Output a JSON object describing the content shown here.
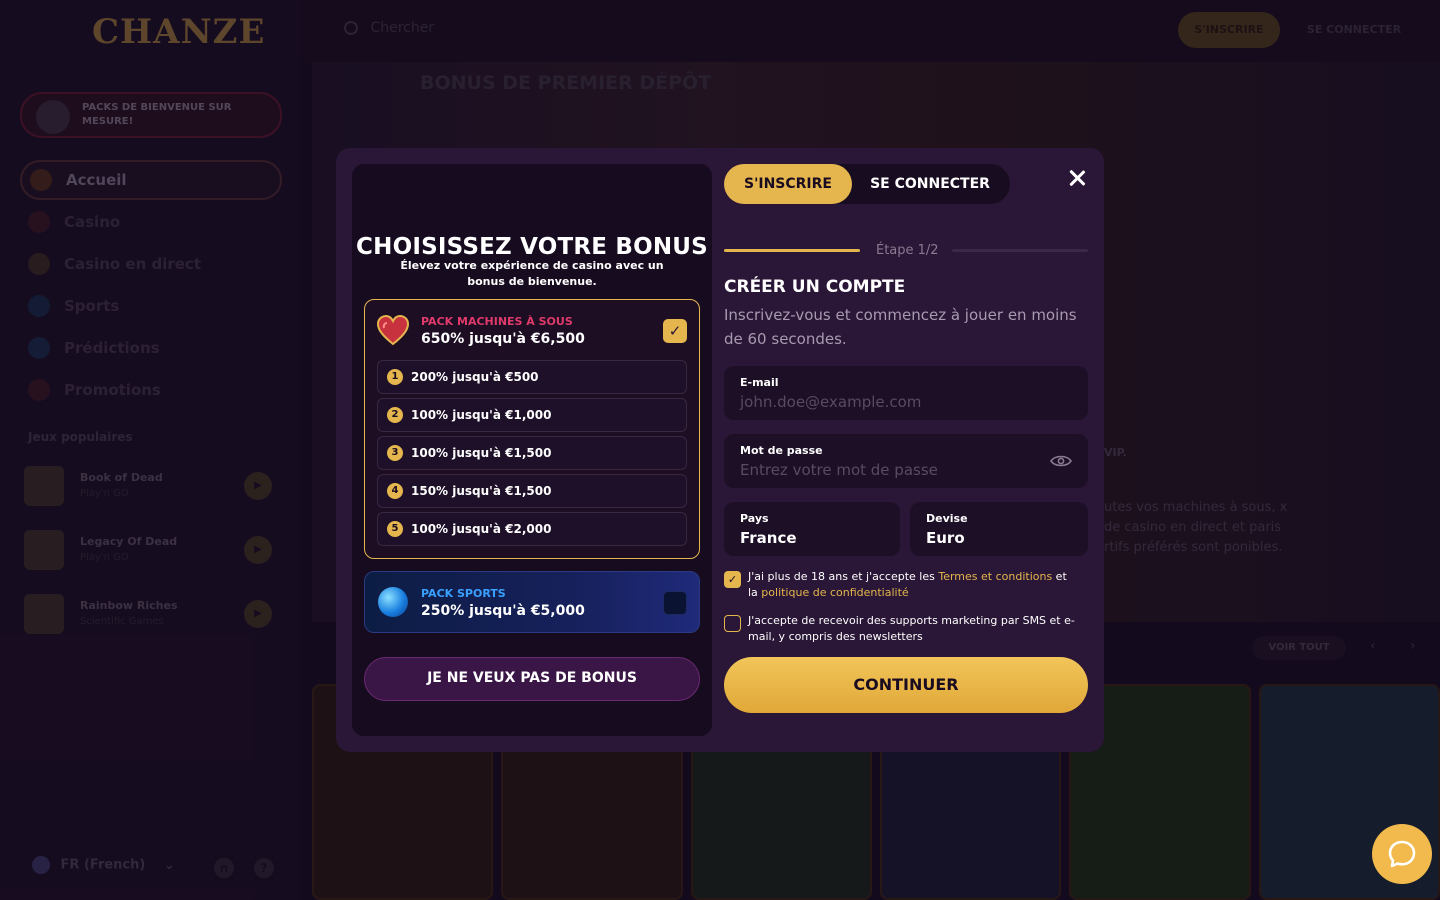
{
  "brand": {
    "logo_text": "CHANZE",
    "accent": "#e5b64e"
  },
  "sidebar": {
    "welcome_pack": "PACKS DE BIENVENUE SUR MESURE!",
    "nav": [
      {
        "label": "Accueil",
        "icon": "home-icon"
      },
      {
        "label": "Casino",
        "icon": "heart-icon"
      },
      {
        "label": "Casino en direct",
        "icon": "live-icon"
      },
      {
        "label": "Sports",
        "icon": "ball-icon"
      },
      {
        "label": "Prédictions",
        "icon": "chart-icon"
      },
      {
        "label": "Promotions",
        "icon": "gem-icon"
      }
    ],
    "popular_title": "Jeux populaires",
    "popular_games": [
      {
        "name": "Book of Dead",
        "provider": "Play'n GO"
      },
      {
        "name": "Legacy Of Dead",
        "provider": "Play'n GO"
      },
      {
        "name": "Rainbow Riches",
        "provider": "Scientific Games"
      }
    ],
    "language": "FR (French)"
  },
  "topbar": {
    "search_placeholder": "Chercher",
    "register": "S'INSCRIRE",
    "login": "SE CONNECTER"
  },
  "banner": {
    "title": "BONUS DE PREMIER DÉPÔT",
    "vip": "VIP.",
    "side_text": "utes vos machines à sous, x de casino en direct et paris rtifs préférés sont ponibles."
  },
  "games_row": {
    "see_all": "VOIR TOUT"
  },
  "modal": {
    "bonus": {
      "title": "CHOISISSEZ VOTRE BONUS",
      "subtitle": "Élevez votre expérience de casino avec un bonus de bienvenue.",
      "slots_pack": {
        "label": "PACK MACHINES À SOUS",
        "amount": "650% jusqu'à €6,500",
        "selected": true,
        "tiers": [
          {
            "num": "1",
            "text": "200% jusqu'à €500"
          },
          {
            "num": "2",
            "text": "100% jusqu'à €1,000"
          },
          {
            "num": "3",
            "text": "100% jusqu'à €1,500"
          },
          {
            "num": "4",
            "text": "150% jusqu'à €1,500"
          },
          {
            "num": "5",
            "text": "100% jusqu'à €2,000"
          }
        ]
      },
      "sports_pack": {
        "label": "PACK SPORTS",
        "amount": "250% jusqu'à €5,000",
        "selected": false
      },
      "no_bonus": "JE NE VEUX PAS DE BONUS"
    },
    "tabs": {
      "register": "S'INSCRIRE",
      "login": "SE CONNECTER"
    },
    "step": "Étape 1/2",
    "form": {
      "title": "CRÉER UN COMPTE",
      "subtitle": "Inscrivez-vous et commencez à jouer en moins de 60 secondes.",
      "email_label": "E-mail",
      "email_placeholder": "john.doe@example.com",
      "password_label": "Mot de passe",
      "password_placeholder": "Entrez votre mot de passe",
      "country_label": "Pays",
      "country_value": "France",
      "currency_label": "Devise",
      "currency_value": "Euro",
      "terms_pre": "J'ai plus de 18 ans et j'accepte les ",
      "terms_link": "Termes et conditions",
      "terms_mid": " et la ",
      "privacy_link": "politique de confidentialité",
      "terms_checked": true,
      "marketing_text": "J'accepte de recevoir des supports marketing par SMS et e-mail, y compris des newsletters",
      "marketing_checked": false,
      "continue": "CONTINUER"
    }
  }
}
